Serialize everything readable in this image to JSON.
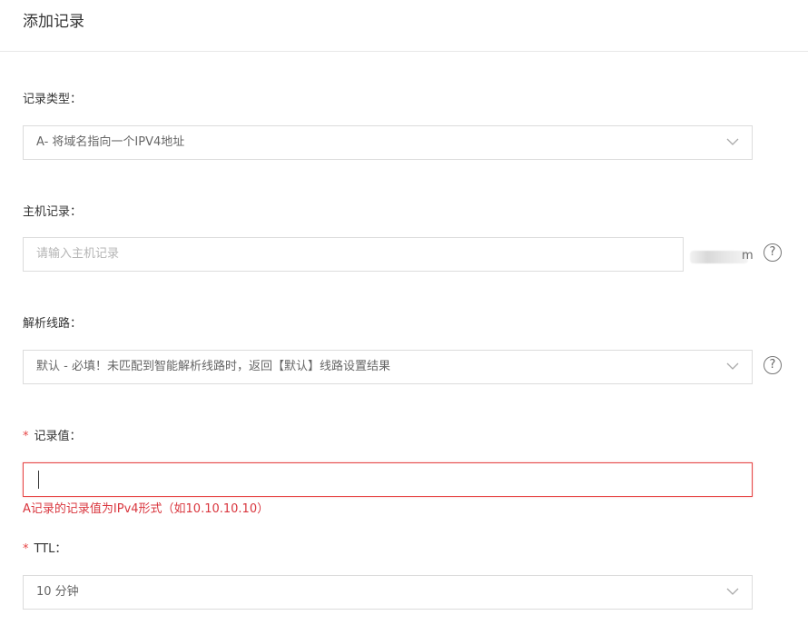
{
  "dialog": {
    "title": "添加记录"
  },
  "record_type": {
    "label": "记录类型：",
    "value": "A- 将域名指向一个IPV4地址"
  },
  "host_record": {
    "label": "主机记录：",
    "placeholder": "请输入主机记录",
    "domain_suffix_visible_end": "m"
  },
  "resolve_line": {
    "label": "解析线路：",
    "value": "默认 - 必填！未匹配到智能解析线路时，返回【默认】线路设置结果"
  },
  "record_value": {
    "required_mark": "*",
    "label": "记录值：",
    "value": "",
    "error": "A记录的记录值为IPv4形式（如10.10.10.10）"
  },
  "ttl": {
    "required_mark": "*",
    "label": "TTL：",
    "value": "10 分钟"
  },
  "help_glyph": "?",
  "colors": {
    "error": "#e64545",
    "border": "#dcdcdc"
  }
}
